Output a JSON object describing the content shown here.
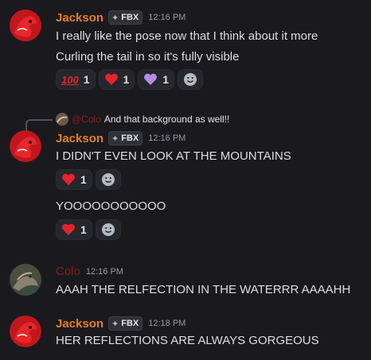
{
  "colors": {
    "background": "#1a1a1e",
    "jackson_name": "#e67e22",
    "colo_name": "#8c1a1a",
    "text": "#dbdee1",
    "timestamp": "#949ba4",
    "reaction_bg": "#26272d"
  },
  "messages": [
    {
      "author": "Jackson",
      "tag": "FBX",
      "time": "12:16 PM",
      "lines": [
        "I really like the pose now that I think about it more",
        "Curling the tail in so it's fully visible"
      ],
      "reactions": [
        {
          "icon": "hundred-points-icon",
          "count": "1"
        },
        {
          "icon": "red-heart-icon",
          "count": "1"
        },
        {
          "icon": "purple-heart-icon",
          "count": "1"
        }
      ]
    },
    {
      "reply_to": {
        "author": "@Colo",
        "text": "And that background as well!!"
      },
      "author": "Jackson",
      "tag": "FBX",
      "time": "12:16 PM",
      "lines": [
        "I DIDN'T EVEN LOOK AT THE MOUNTAINS"
      ],
      "reactions": [
        {
          "icon": "red-heart-icon",
          "count": "1"
        }
      ],
      "followup": {
        "text": "YOOOOOOOOOOO",
        "reactions": [
          {
            "icon": "red-heart-icon",
            "count": "1"
          }
        ]
      }
    },
    {
      "author": "Colo",
      "time": "12:16 PM",
      "lines": [
        "AAAH THE RELFECTION IN THE WATERRR AAAAHH"
      ]
    },
    {
      "author": "Jackson",
      "tag": "FBX",
      "time": "12:18 PM",
      "lines": [
        "HER REFLECTIONS ARE ALWAYS GORGEOUS"
      ]
    }
  ]
}
